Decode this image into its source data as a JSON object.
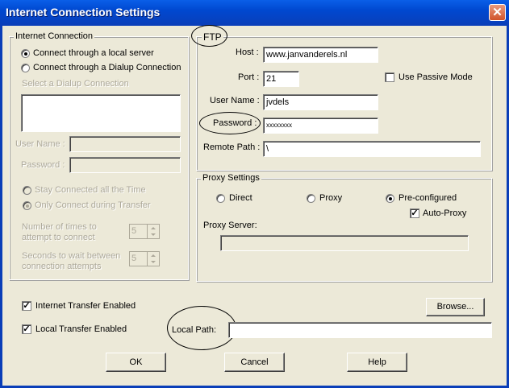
{
  "window": {
    "title": "Internet Connection Settings",
    "close_label": "✕"
  },
  "internet_connection": {
    "legend": "Internet Connection",
    "local_server_label": "Connect through a local server",
    "dialup_label": "Connect through a Dialup Connection",
    "select_dialup_label": "Select a Dialup Connection",
    "username_label": "User Name :",
    "password_label": "Password :",
    "stay_connected_label": "Stay Connected all the Time",
    "only_connect_label": "Only Connect during Transfer",
    "attempts_label_line1": "Number of times to",
    "attempts_label_line2": "attempt to connect",
    "attempts_value": "5",
    "seconds_label_line1": "Seconds to wait between",
    "seconds_label_line2": "connection attempts",
    "seconds_value": "5"
  },
  "ftp": {
    "legend": "FTP",
    "host_label": "Host :",
    "host_value": "www.janvanderels.nl",
    "port_label": "Port :",
    "port_value": "21",
    "passive_label": "Use Passive Mode",
    "username_label": "User Name :",
    "username_value": "jvdels",
    "password_label": "Password :",
    "password_value": "xxxxxxxx",
    "remote_path_label": "Remote Path :",
    "remote_path_value": "\\"
  },
  "proxy": {
    "legend": "Proxy Settings",
    "direct_label": "Direct",
    "proxy_label": "Proxy",
    "preconfigured_label": "Pre-configured",
    "auto_proxy_label": "Auto-Proxy",
    "server_label": "Proxy Server:",
    "server_value": ""
  },
  "bottom": {
    "internet_transfer_label": "Internet Transfer Enabled",
    "local_transfer_label": "Local Transfer Enabled",
    "browse_label": "Browse...",
    "local_path_label": "Local Path:",
    "local_path_value": "",
    "ok_label": "OK",
    "cancel_label": "Cancel",
    "help_label": "Help"
  },
  "colors": {
    "titlebar": "#0A4FD8",
    "dialog_bg": "#ECE9D8",
    "disabled_text": "#ACA899"
  }
}
